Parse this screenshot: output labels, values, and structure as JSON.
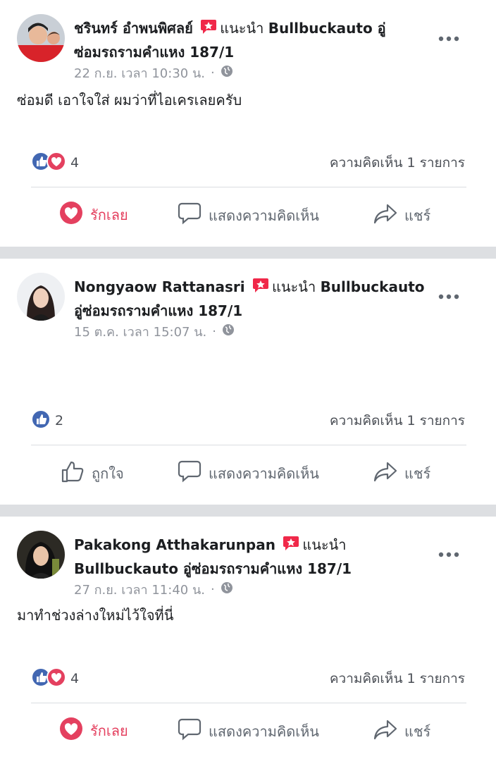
{
  "posts": [
    {
      "author": "ชรินทร์ อำพนพิศลย์",
      "verb": "แนะนำ",
      "page_line1": "Bullbuckauto อู่",
      "page_line2": "ซ่อมรถรามคำแหง 187/1",
      "time": "22 ก.ย. เวลา 10:30 น.",
      "dot": "·",
      "text": "ซ่อมดี เอาใจใส่ ผมว่าที่ไอเครเลยครับ",
      "reaction_count": "4",
      "comments": "ความคิดเห็น 1 รายการ",
      "actions": {
        "like": "รักเลย",
        "comment": "แสดงความคิดเห็น",
        "share": "แชร์"
      }
    },
    {
      "author": "Nongyaow Rattanasri",
      "verb": "แนะนำ",
      "page_line1": "Bullbuckauto",
      "page_line2": "อู่ซ่อมรถรามคำแหง 187/1",
      "time": "15 ต.ค. เวลา 15:07 น.",
      "dot": "·",
      "text": "",
      "reaction_count": "2",
      "comments": "ความคิดเห็น 1 รายการ",
      "actions": {
        "like": "ถูกใจ",
        "comment": "แสดงความคิดเห็น",
        "share": "แชร์"
      }
    },
    {
      "author": "Pakakong Atthakarunpan",
      "verb": "แนะนำ",
      "page_line1": "",
      "page_line2": "Bullbuckauto อู่ซ่อมรถรามคำแหง 187/1",
      "time": "27 ก.ย. เวลา 11:40 น.",
      "dot": "·",
      "text": "มาทำช่วงล่างใหม่ไว้ใจที่นี่",
      "reaction_count": "4",
      "comments": "ความคิดเห็น 1 รายการ",
      "actions": {
        "like": "รักเลย",
        "comment": "แสดงความคิดเห็น",
        "share": "แชร์"
      }
    }
  ],
  "colors": {
    "like_blue": "#4267b2",
    "love_red": "#e4405f",
    "separator": "#dddfe2",
    "muted": "#90949c"
  }
}
